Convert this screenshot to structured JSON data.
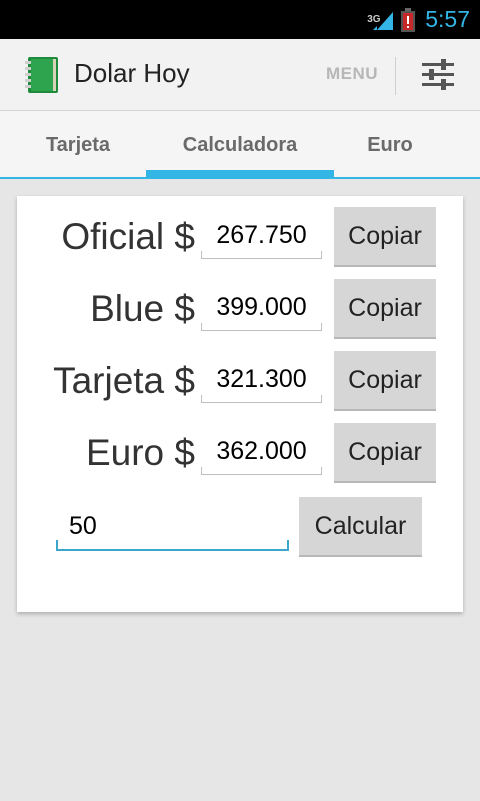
{
  "status_bar": {
    "network": "3G",
    "time": "5:57",
    "colors": {
      "clock": "#33b5e5",
      "battery_alert": "#c62828"
    }
  },
  "action_bar": {
    "app_title": "Dolar Hoy",
    "menu_label": "MENU",
    "app_icon": "green-notebook-icon",
    "overflow_icon": "settings-sliders-icon"
  },
  "tabs": [
    {
      "label": "Tarjeta",
      "selected": false
    },
    {
      "label": "Calculadora",
      "selected": true
    },
    {
      "label": "Euro",
      "selected": false
    }
  ],
  "accent_color": "#33b5e5",
  "rates": [
    {
      "label": "Oficial $",
      "value": "267.750",
      "button": "Copiar"
    },
    {
      "label": "Blue $",
      "value": "399.000",
      "button": "Copiar"
    },
    {
      "label": "Tarjeta $",
      "value": "321.300",
      "button": "Copiar"
    },
    {
      "label": "Euro $",
      "value": "362.000",
      "button": "Copiar"
    }
  ],
  "calculator": {
    "amount_value": "50",
    "calculate_label": "Calcular"
  }
}
